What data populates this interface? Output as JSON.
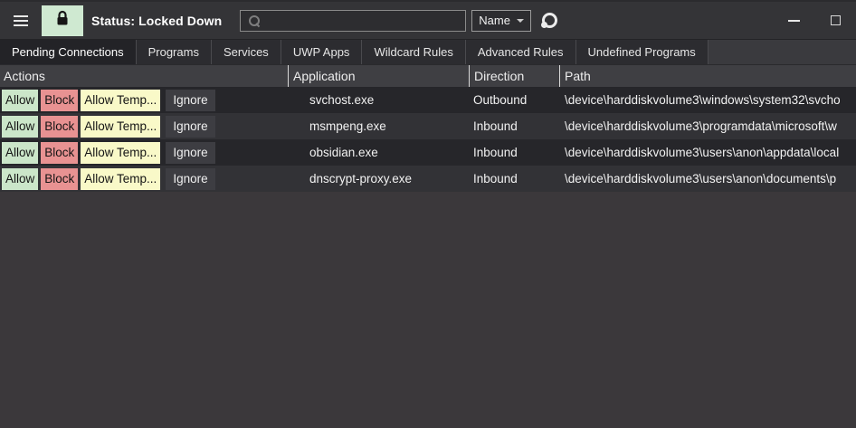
{
  "titlebar": {
    "status": "Status: Locked Down",
    "search_value": "",
    "search_placeholder": "",
    "filter_label": "Name"
  },
  "icons": {
    "menu": "hamburger",
    "lock_button": "padlock",
    "search": "magnifier",
    "filter_caret": "chevron-down",
    "app_logo": "ring-with-dot",
    "minimize": "minimize-line",
    "maximize": "maximize-square"
  },
  "colors": {
    "lock_button_bg": "#cfe9d1",
    "allow_bg": "#cbe6c9",
    "block_bg": "#e89292",
    "allow_temp_bg": "#f9f9c8",
    "ignore_bg": "#3d3d42",
    "titlebar_bg": "#343437",
    "row_odd_bg": "#26262a",
    "row_even_bg": "#323236",
    "empty_area_bg": "#3b383b"
  },
  "tabs": [
    {
      "label": "Pending Connections",
      "active": true
    },
    {
      "label": "Programs",
      "active": false
    },
    {
      "label": "Services",
      "active": false
    },
    {
      "label": "UWP Apps",
      "active": false
    },
    {
      "label": "Wildcard Rules",
      "active": false
    },
    {
      "label": "Advanced Rules",
      "active": false
    },
    {
      "label": "Undefined Programs",
      "active": false
    }
  ],
  "table": {
    "columns": [
      "Actions",
      "Application",
      "Direction",
      "Path"
    ],
    "action_buttons": [
      "Allow",
      "Block",
      "Allow Temp...",
      "Ignore"
    ],
    "rows": [
      {
        "application": "svchost.exe",
        "direction": "Outbound",
        "path": "\\device\\harddiskvolume3\\windows\\system32\\svcho"
      },
      {
        "application": "msmpeng.exe",
        "direction": "Inbound",
        "path": "\\device\\harddiskvolume3\\programdata\\microsoft\\w"
      },
      {
        "application": "obsidian.exe",
        "direction": "Inbound",
        "path": "\\device\\harddiskvolume3\\users\\anon\\appdata\\local"
      },
      {
        "application": "dnscrypt-proxy.exe",
        "direction": "Inbound",
        "path": "\\device\\harddiskvolume3\\users\\anon\\documents\\p"
      }
    ]
  }
}
